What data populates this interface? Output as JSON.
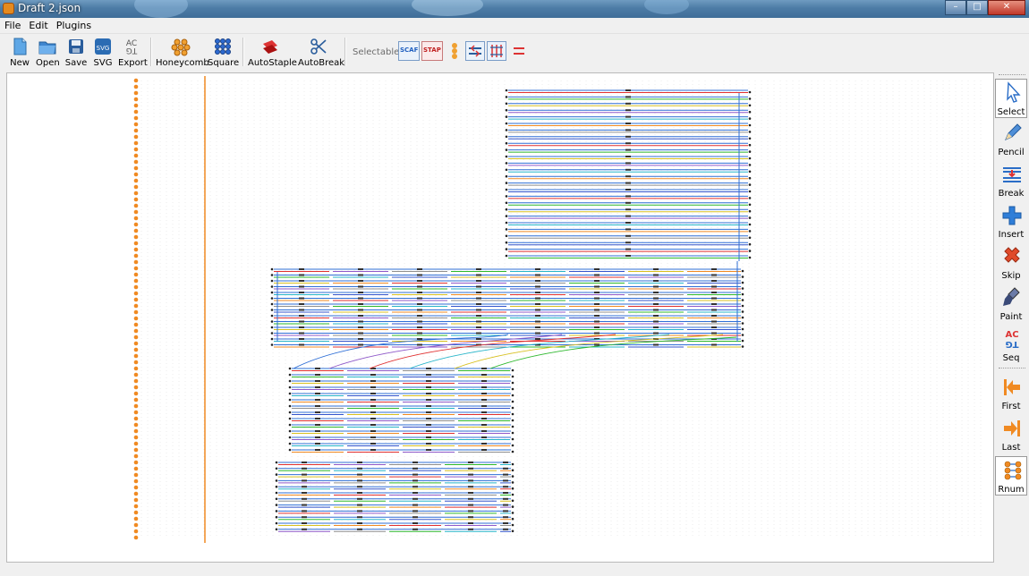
{
  "window": {
    "title": "Draft 2.json"
  },
  "menu": [
    "File",
    "Edit",
    "Plugins"
  ],
  "toolbar": {
    "new": "New",
    "open": "Open",
    "save": "Save",
    "svg": "SVG",
    "export": "Export",
    "honeycomb": "Honeycomb",
    "square": "Square",
    "autostaple": "AutoStaple",
    "autobreak": "AutoBreak",
    "selectable": "Selectable:",
    "scaf": "SCAF",
    "stap": "STAP"
  },
  "tools": {
    "select": "Select",
    "pencil": "Pencil",
    "break": "Break",
    "insert": "Insert",
    "skip": "Skip",
    "paint": "Paint",
    "seq": "Seq",
    "first": "First",
    "last": "Last",
    "rnum": "Rnum"
  },
  "icon_text": {
    "export": "AC\nTG",
    "seq": "AC\nTG"
  },
  "colors": {
    "scaffold": "#2f6fd6",
    "staple_colors": [
      "#e03030",
      "#2db82d",
      "#d8c020",
      "#8f59c9",
      "#27b5c9",
      "#f08a22",
      "#8f8f8f",
      "#3355cc"
    ],
    "helix_marker": "#f08a22",
    "grid_line": "#d8d8d8"
  }
}
